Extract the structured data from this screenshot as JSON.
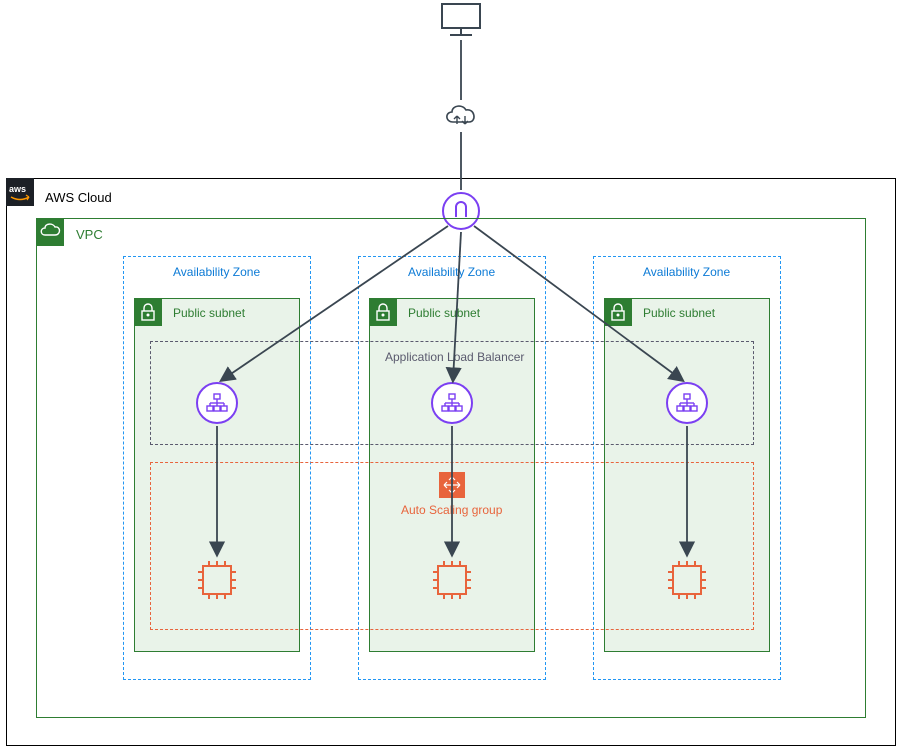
{
  "diagram": {
    "cloud_label": "AWS Cloud",
    "vpc_label": "VPC",
    "az_label": "Availability Zone",
    "subnet_label": "Public subnet",
    "alb_label": "Application Load Balancer",
    "asg_label": "Auto Scaling group",
    "icons": {
      "client": "client-computer-icon",
      "internet": "internet-gateway-icon",
      "igw": "aws-internet-gateway-icon",
      "aws": "aws-logo-icon",
      "vpc": "vpc-icon",
      "subnet_lock": "subnet-lock-icon",
      "alb_node": "load-balancer-icon",
      "asg": "auto-scaling-group-icon",
      "instance": "ec2-instance-icon"
    },
    "colors": {
      "aws_border": "#000000",
      "vpc_border": "#2e7d32",
      "az_border": "#2196f3",
      "subnet_fill": "#e6f3e6",
      "subnet_border": "#2e7d32",
      "alb_border": "#5a5a6e",
      "asg_border": "#e8643c",
      "instance": "#e8643c",
      "purple": "#7b3ff2"
    }
  }
}
